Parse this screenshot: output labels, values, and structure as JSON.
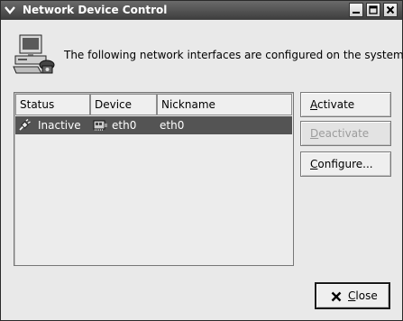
{
  "window": {
    "title": "Network Device Control"
  },
  "header": {
    "message": "The following network interfaces are configured on the system."
  },
  "table": {
    "columns": [
      "Status",
      "Device",
      "Nickname"
    ],
    "rows": [
      {
        "status": "Inactive",
        "device": "eth0",
        "nickname": "eth0",
        "selected": true
      }
    ]
  },
  "buttons": {
    "activate": {
      "pre": "",
      "mnemonic": "A",
      "post": "ctivate"
    },
    "deactivate": {
      "pre": "",
      "mnemonic": "D",
      "post": "eactivate"
    },
    "configure": {
      "pre": "",
      "mnemonic": "C",
      "post": "onfigure..."
    },
    "close": {
      "pre": "",
      "mnemonic": "C",
      "post": "lose"
    }
  },
  "icons": {
    "window_menu": "chevron-down-icon",
    "minimize": "minimize-icon",
    "maximize": "maximize-icon",
    "close": "close-icon",
    "header": "computer-network-icon",
    "status_inactive": "disconnected-plug-icon",
    "device": "network-card-icon"
  }
}
